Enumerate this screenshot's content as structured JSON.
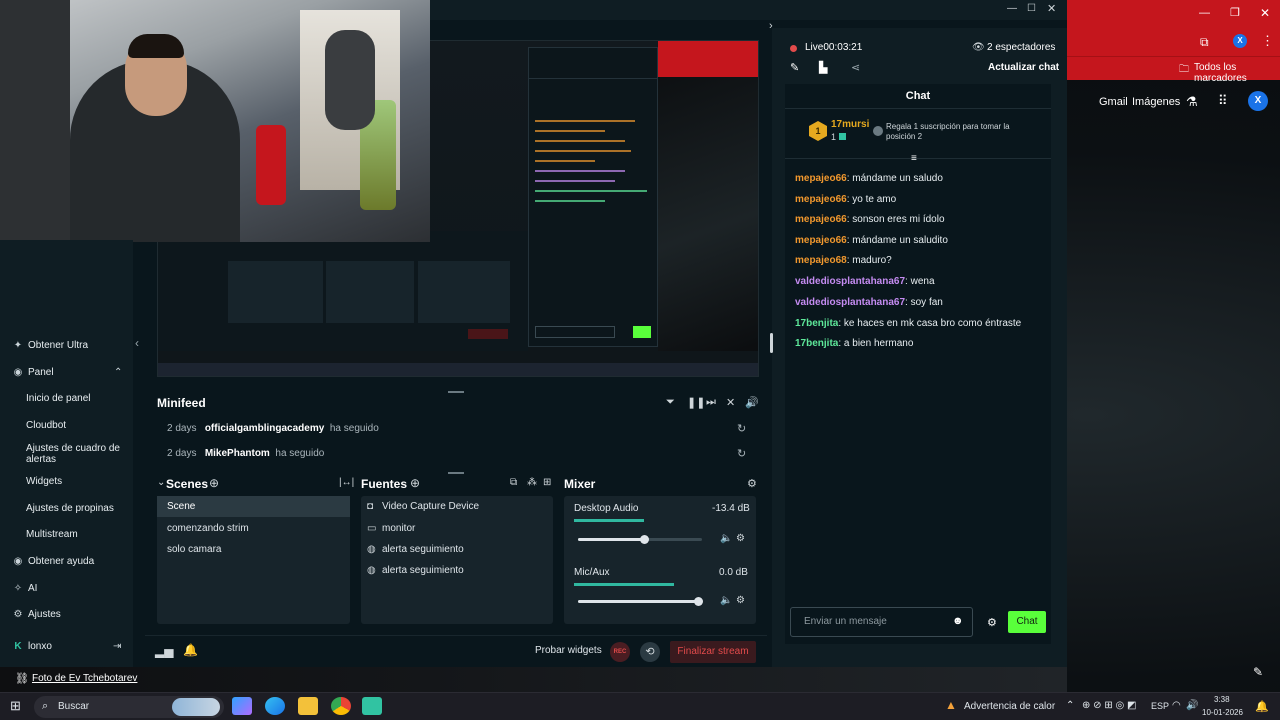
{
  "stream": {
    "live": "Live",
    "time": "00:03:21",
    "viewers": "2 espectadores",
    "update_chat": "Actualizar chat"
  },
  "chat": {
    "title": "Chat",
    "top_user": "17mursi",
    "top_rank": "1",
    "top_count": "1",
    "gift_prompt": "Regala 1 suscripción para tomar la posición 2",
    "messages": [
      {
        "user": "mepajeo66",
        "text": ": mándame un saludo",
        "color": "orange"
      },
      {
        "user": "mepajeo66",
        "text": ": yo te amo",
        "color": "orange"
      },
      {
        "user": "mepajeo66",
        "text": ": sonson eres mi ídolo",
        "color": "orange"
      },
      {
        "user": "mepajeo66",
        "text": ": mándame un saludito",
        "color": "orange"
      },
      {
        "user": "mepajeo68",
        "text": ": maduro?",
        "color": "orange"
      },
      {
        "user": "valdediosplantahana67",
        "text": ": wena",
        "color": "purple"
      },
      {
        "user": "valdediosplantahana67",
        "text": ": soy fan",
        "color": "purple"
      },
      {
        "user": "17benjita",
        "text": ": ke haces en mk casa bro como éntraste",
        "color": "green"
      },
      {
        "user": "17benjita",
        "text": ": a bien hermano",
        "color": "green"
      }
    ],
    "input_placeholder": "Enviar un mensaje",
    "send_label": "Chat"
  },
  "sidebar": {
    "items": [
      {
        "label": "Obtener Ultra",
        "icon": "ultra-icon"
      },
      {
        "label": "Panel",
        "icon": "dashboard-icon"
      },
      {
        "label": "Inicio de panel"
      },
      {
        "label": "Cloudbot"
      },
      {
        "label": "Ajustes de cuadro de alertas"
      },
      {
        "label": "Widgets"
      },
      {
        "label": "Ajustes de propinas"
      },
      {
        "label": "Multistream"
      },
      {
        "label": "Obtener ayuda",
        "icon": "help-icon"
      },
      {
        "label": "AI",
        "icon": "ai-icon"
      },
      {
        "label": "Ajustes",
        "icon": "gear-icon"
      }
    ],
    "user": "lonxo"
  },
  "minifeed": {
    "title": "Minifeed",
    "events": [
      {
        "when": "2 days",
        "name": "officialgamblingacademy",
        "action": "ha seguido"
      },
      {
        "when": "2 days",
        "name": "MikePhantom",
        "action": "ha seguido"
      }
    ]
  },
  "scenes": {
    "title": "Scenes",
    "items": [
      "Scene",
      "comenzando strim",
      "solo camara"
    ]
  },
  "sources": {
    "title": "Fuentes",
    "items": [
      {
        "label": "Video Capture Device",
        "icon": "camera-icon"
      },
      {
        "label": "monitor",
        "icon": "monitor-icon"
      },
      {
        "label": "alerta seguimiento",
        "icon": "globe-icon"
      },
      {
        "label": "alerta seguimiento",
        "icon": "globe-icon"
      }
    ]
  },
  "mixer": {
    "title": "Mixer",
    "channels": [
      {
        "name": "Desktop Audio",
        "db": "-13.4 dB",
        "level": 0.53
      },
      {
        "name": "Mic/Aux",
        "db": "0.0 dB",
        "level": 0.97
      }
    ]
  },
  "bottom": {
    "test_widgets": "Probar widgets",
    "rec": "REC",
    "end_stream": "Finalizar stream"
  },
  "browser": {
    "bookmarks": "Todos los marcadores",
    "gmail": "Gmail",
    "images": "Imágenes",
    "avatar": "X"
  },
  "photo_credit": "Foto de Ev Tchebotarev",
  "taskbar": {
    "search": "Buscar",
    "weather": "Advertencia de calor",
    "lang": "ESP",
    "time": "3:38",
    "date": "10-01-2026"
  },
  "colors": {
    "accent": "#31c3a2",
    "live_red": "#e24b4b",
    "send_green": "#59ff3b",
    "end_red": "#d13a3a"
  }
}
